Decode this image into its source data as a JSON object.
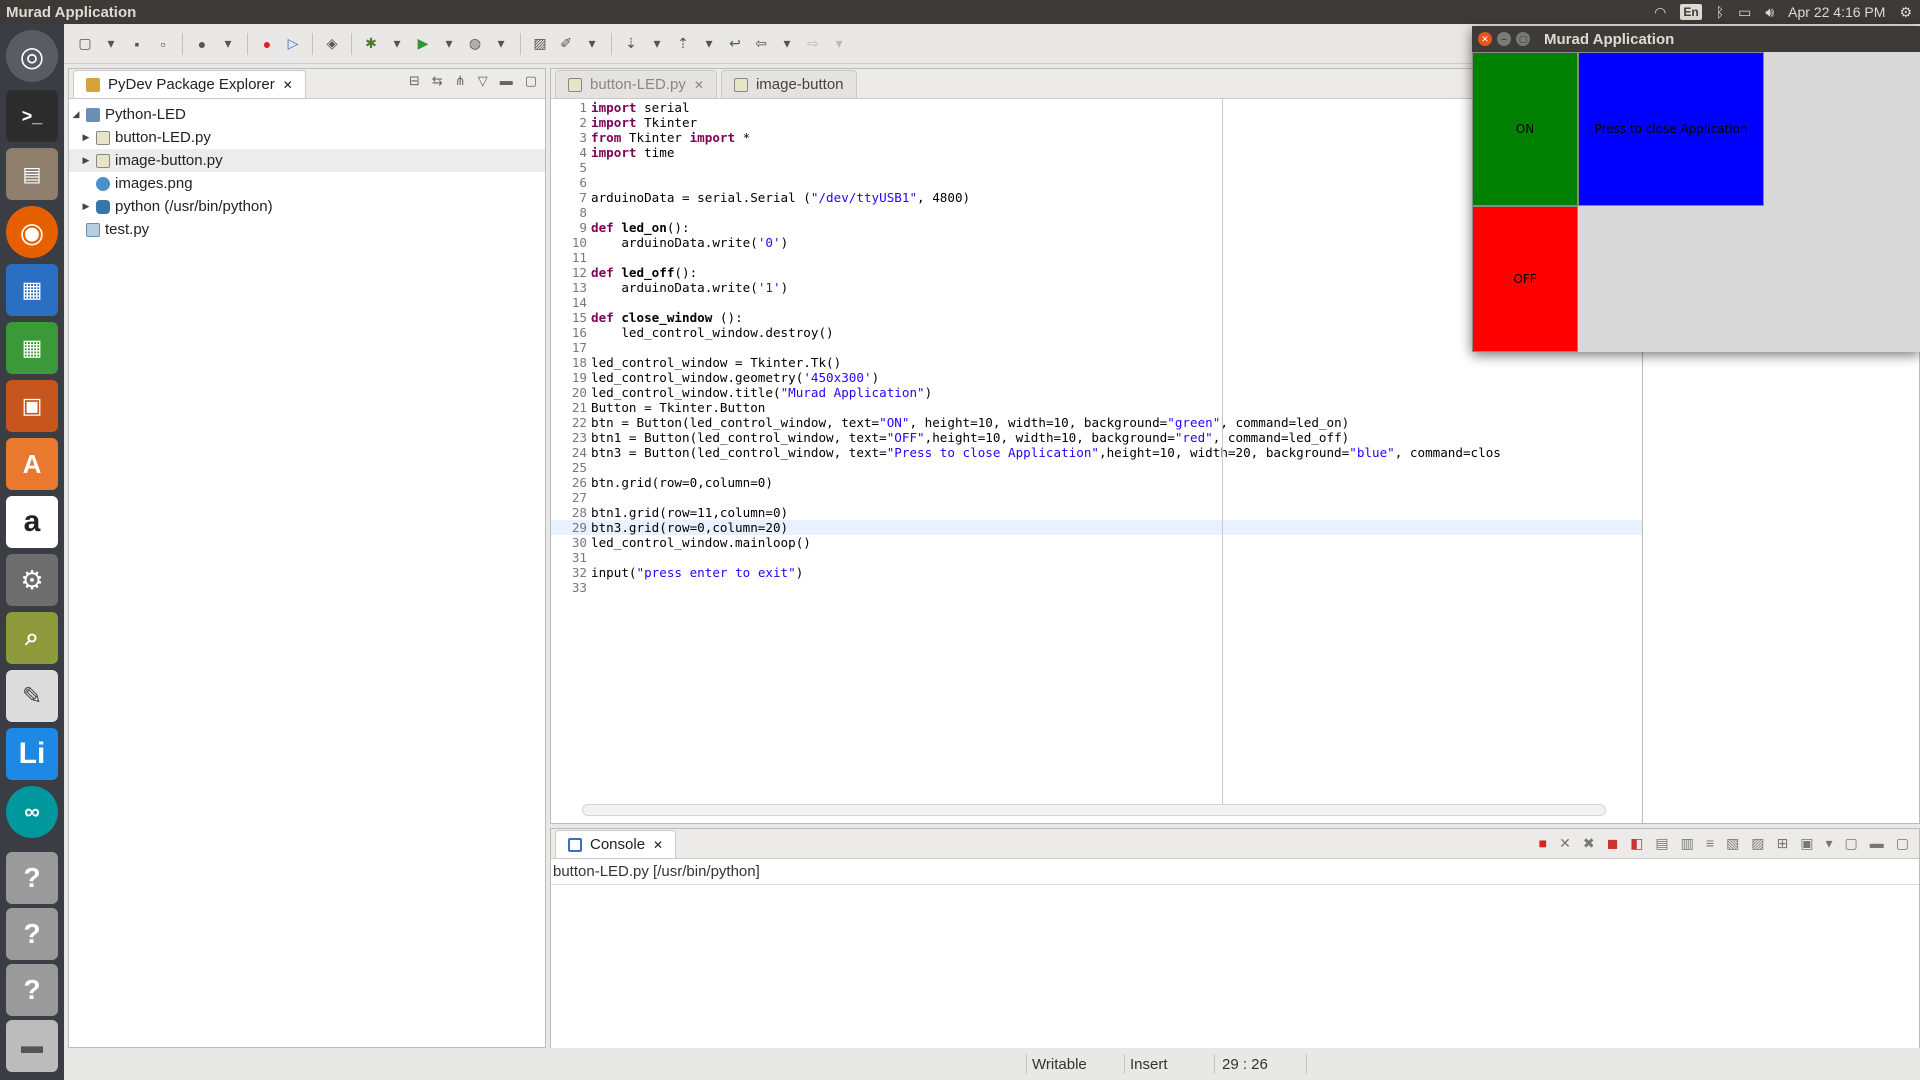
{
  "topbar": {
    "app_title": "Murad Application",
    "language": "En",
    "datetime": "Apr 22  4:16 PM"
  },
  "launcher": {
    "items": [
      "ubuntu-dash-icon",
      "terminal-icon",
      "files-icon",
      "firefox-icon",
      "writer-icon",
      "calc-icon",
      "impress-icon",
      "software-center-icon",
      "amazon-icon",
      "system-settings-icon",
      "image-viewer-icon",
      "text-editor-icon",
      "libreoffice-icon",
      "arduino-icon",
      "unknown-app-icon",
      "unknown-app-icon",
      "unknown-app-icon",
      "drive-icon"
    ]
  },
  "explorer": {
    "tab_label": "PyDev Package Explorer",
    "tree": [
      {
        "label": "Python-LED",
        "level": 0,
        "expanded": true
      },
      {
        "label": "button-LED.py",
        "level": 1
      },
      {
        "label": "image-button.py",
        "level": 1,
        "selected": true
      },
      {
        "label": "images.png",
        "level": 1
      },
      {
        "label": "python  (/usr/bin/python)",
        "level": 1
      },
      {
        "label": "test.py",
        "level": 0
      }
    ]
  },
  "editor": {
    "tabs": [
      {
        "label": "button-LED.py",
        "active": false
      },
      {
        "label": "image-button",
        "active": false
      }
    ],
    "current_line": 29,
    "lines": [
      "import serial",
      "import Tkinter",
      "from Tkinter import *",
      "import time",
      "",
      "",
      "arduinoData = serial.Serial (\"/dev/ttyUSB1\", 4800)",
      "",
      "def led_on():",
      "    arduinoData.write('0')",
      "",
      "def led_off():",
      "    arduinoData.write('1')",
      "",
      "def close_window ():",
      "    led_control_window.destroy()",
      "",
      "led_control_window = Tkinter.Tk()",
      "led_control_window.geometry('450x300')",
      "led_control_window.title(\"Murad Application\")",
      "Button = Tkinter.Button",
      "btn = Button(led_control_window, text=\"ON\", height=10, width=10, background=\"green\", command=led_on)",
      "btn1 = Button(led_control_window, text=\"OFF\",height=10, width=10, background=\"red\", command=led_off)",
      "btn3 = Button(led_control_window, text=\"Press to close Application\",height=10, width=20, background=\"blue\", command=clos",
      "",
      "btn.grid(row=0,column=0)",
      "",
      "btn1.grid(row=11,column=0)",
      "btn3.grid(row=0,column=20)",
      "led_control_window.mainloop()",
      "",
      "input(\"press enter to exit\")",
      ""
    ]
  },
  "console": {
    "tab_label": "Console",
    "path": "button-LED.py [/usr/bin/python]"
  },
  "statusbar": {
    "mode1": "Writable",
    "mode2": "Insert",
    "position": "29 : 26"
  },
  "tk_window": {
    "title": "Murad Application",
    "buttons": [
      {
        "label": "ON",
        "color": "#008000"
      },
      {
        "label": "Press to close Application",
        "color": "#0000ff"
      },
      {
        "label": "OFF",
        "color": "#ff0000"
      }
    ]
  }
}
